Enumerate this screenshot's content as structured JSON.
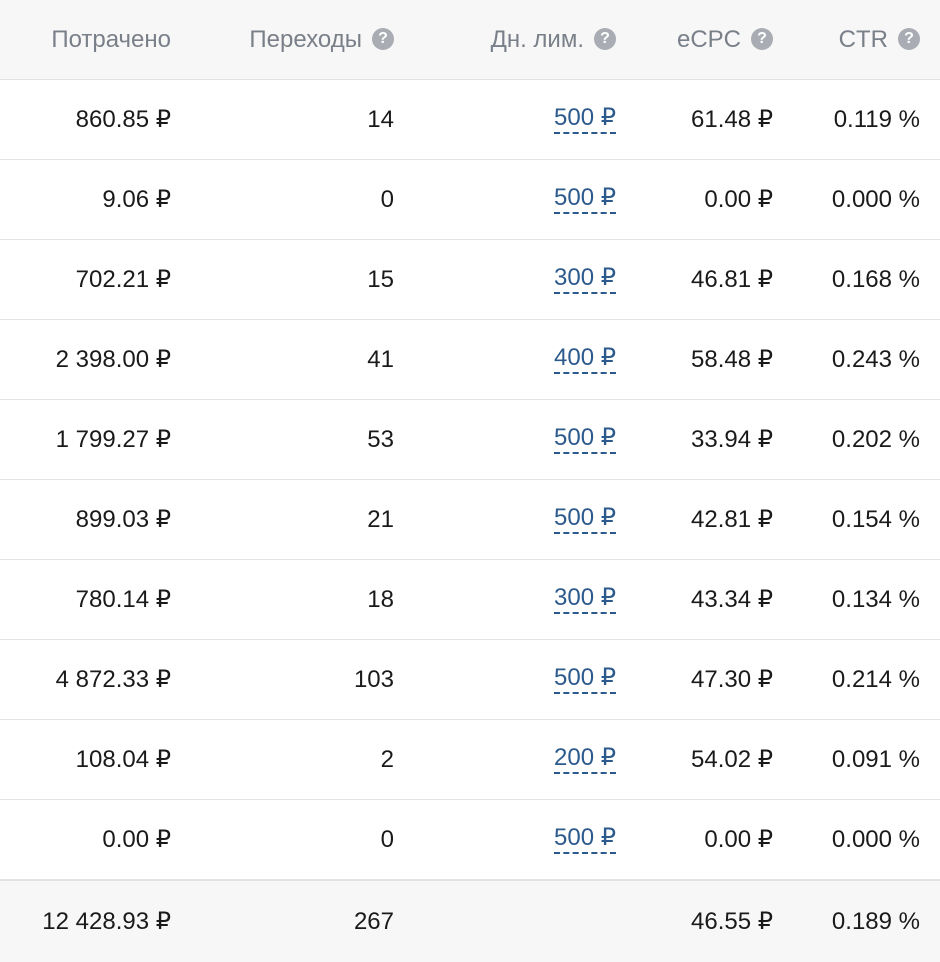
{
  "columns": {
    "spent": "Потрачено",
    "clicks": "Переходы",
    "daily_limit": "Дн. лим.",
    "ecpc": "eCPC",
    "ctr": "CTR"
  },
  "help_glyph": "?",
  "rows": [
    {
      "spent": "860.85 ₽",
      "clicks": "14",
      "limit": "500 ₽",
      "ecpc": "61.48 ₽",
      "ctr": "0.119 %"
    },
    {
      "spent": "9.06 ₽",
      "clicks": "0",
      "limit": "500 ₽",
      "ecpc": "0.00 ₽",
      "ctr": "0.000 %"
    },
    {
      "spent": "702.21 ₽",
      "clicks": "15",
      "limit": "300 ₽",
      "ecpc": "46.81 ₽",
      "ctr": "0.168 %"
    },
    {
      "spent": "2 398.00 ₽",
      "clicks": "41",
      "limit": "400 ₽",
      "ecpc": "58.48 ₽",
      "ctr": "0.243 %"
    },
    {
      "spent": "1 799.27 ₽",
      "clicks": "53",
      "limit": "500 ₽",
      "ecpc": "33.94 ₽",
      "ctr": "0.202 %"
    },
    {
      "spent": "899.03 ₽",
      "clicks": "21",
      "limit": "500 ₽",
      "ecpc": "42.81 ₽",
      "ctr": "0.154 %"
    },
    {
      "spent": "780.14 ₽",
      "clicks": "18",
      "limit": "300 ₽",
      "ecpc": "43.34 ₽",
      "ctr": "0.134 %"
    },
    {
      "spent": "4 872.33 ₽",
      "clicks": "103",
      "limit": "500 ₽",
      "ecpc": "47.30 ₽",
      "ctr": "0.214 %"
    },
    {
      "spent": "108.04 ₽",
      "clicks": "2",
      "limit": "200 ₽",
      "ecpc": "54.02 ₽",
      "ctr": "0.091 %"
    },
    {
      "spent": "0.00 ₽",
      "clicks": "0",
      "limit": "500 ₽",
      "ecpc": "0.00 ₽",
      "ctr": "0.000 %"
    }
  ],
  "total": {
    "spent": "12 428.93 ₽",
    "clicks": "267",
    "ecpc": "46.55 ₽",
    "ctr": "0.189 %"
  },
  "colors": {
    "header_text": "#7a8089",
    "link": "#2c5a8c",
    "help_icon_bg": "#a9adb3",
    "header_bg": "#f7f7f7",
    "divider": "#e3e3e3"
  }
}
